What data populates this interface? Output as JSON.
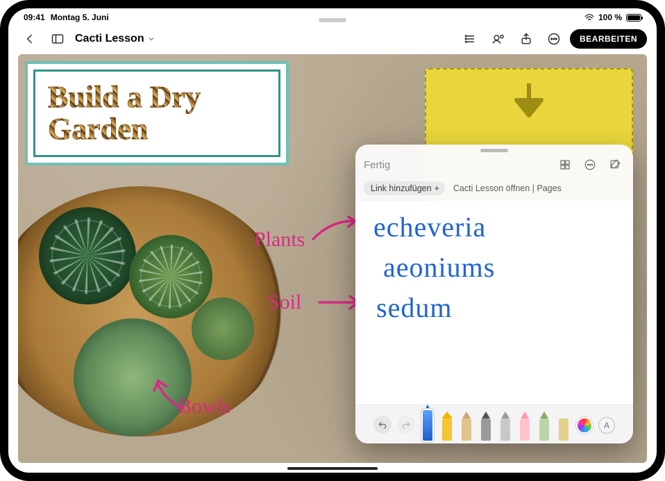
{
  "status": {
    "time": "09:41",
    "date": "Montag 5. Juni",
    "battery_pct": "100 %"
  },
  "toolbar": {
    "doc_title": "Cacti Lesson",
    "edit_label": "BEARBEITEN"
  },
  "document": {
    "title_line1": "Build a Dry",
    "title_line2": "Garden",
    "annot_plants": "Plants",
    "annot_soil": "Soil",
    "annot_bowls": "Bowls"
  },
  "note": {
    "done_label": "Fertig",
    "link_add_label": "Link hinzufügen",
    "open_link_label": "Cacti Lesson öffnen | Pages",
    "lines": {
      "l1": "echeveria",
      "l2": "aeoniums",
      "l3": "sedum"
    },
    "text_tool_glyph": "A"
  }
}
